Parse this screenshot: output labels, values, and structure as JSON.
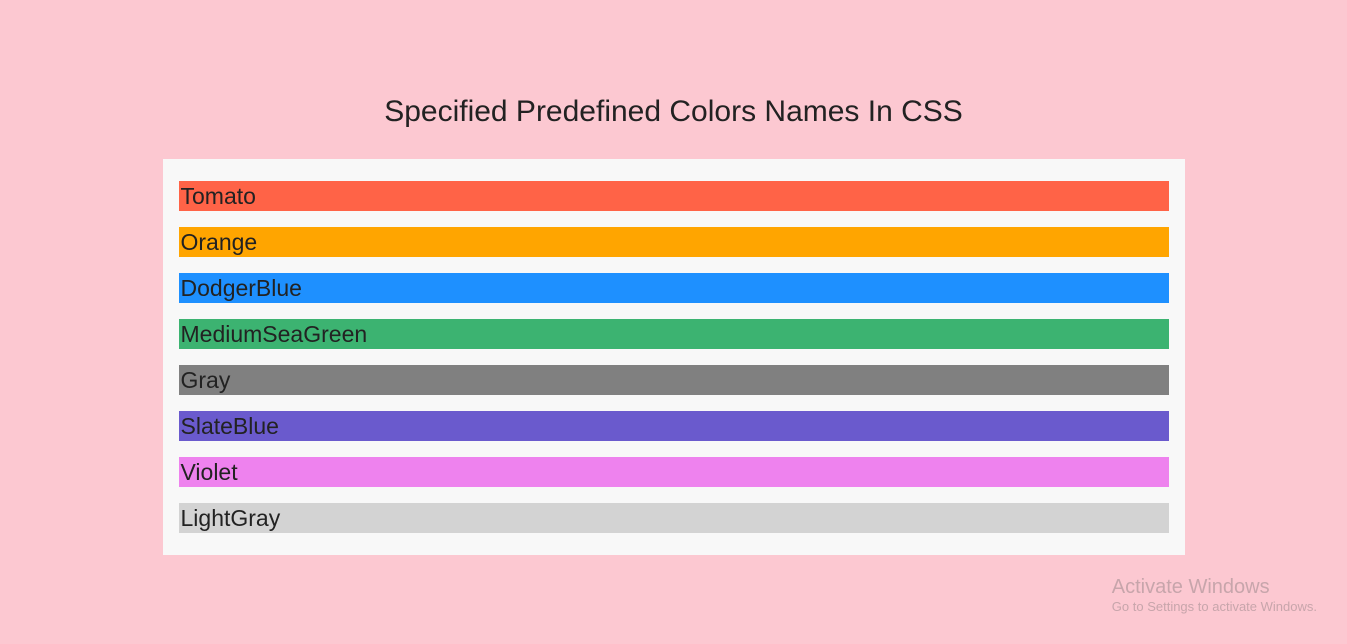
{
  "title": "Specified Predefined Colors Names In CSS",
  "colors": [
    {
      "name": "Tomato",
      "value": "Tomato"
    },
    {
      "name": "Orange",
      "value": "Orange"
    },
    {
      "name": "DodgerBlue",
      "value": "DodgerBlue"
    },
    {
      "name": "MediumSeaGreen",
      "value": "MediumSeaGreen"
    },
    {
      "name": "Gray",
      "value": "Gray"
    },
    {
      "name": "SlateBlue",
      "value": "SlateBlue"
    },
    {
      "name": "Violet",
      "value": "Violet"
    },
    {
      "name": "LightGray",
      "value": "LightGray"
    }
  ],
  "watermark": {
    "line1": "Activate Windows",
    "line2": "Go to Settings to activate Windows."
  }
}
